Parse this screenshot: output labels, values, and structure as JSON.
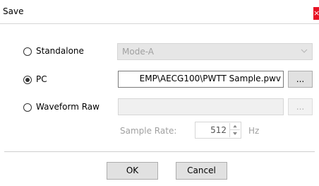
{
  "window": {
    "title": "Save",
    "close_glyph": "×"
  },
  "options": {
    "standalone": {
      "label": "Standalone",
      "selected": false,
      "mode_value": "Mode-A"
    },
    "pc": {
      "label": "PC",
      "selected": true,
      "path_value": "EMP\\AECG100\\PWTT Sample.pwv",
      "browse_label": "..."
    },
    "waveform_raw": {
      "label": "Waveform Raw",
      "selected": false,
      "path_value": "",
      "browse_label": "...",
      "sample_rate_label": "Sample Rate:",
      "sample_rate_value": "512",
      "sample_rate_unit": "Hz"
    }
  },
  "buttons": {
    "ok_label": "OK",
    "cancel_label": "Cancel"
  },
  "icons": {
    "close": "close-icon",
    "dropdown": "chevron-down-icon",
    "spin_up": "spin-up-arrow-icon",
    "spin_down": "spin-down-arrow-icon"
  },
  "colors": {
    "close_button": "#e81123",
    "disabled_text": "#a0a0a0"
  }
}
